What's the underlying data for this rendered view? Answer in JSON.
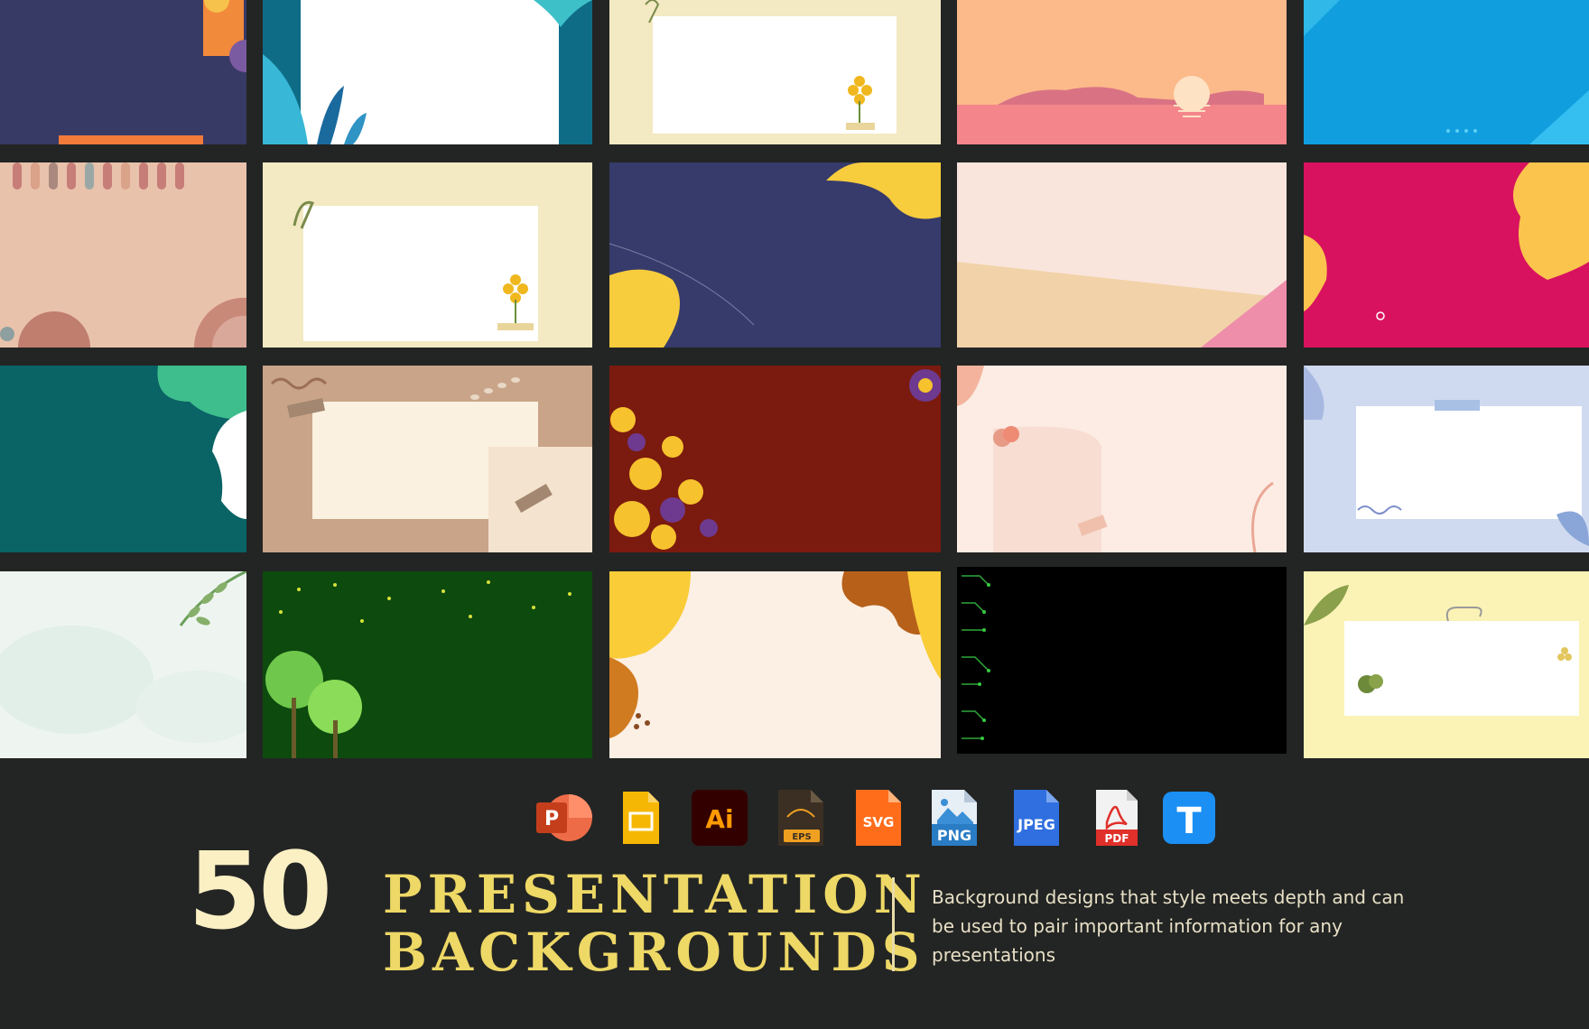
{
  "headline": {
    "count": "50",
    "title_line1": "PRESENTATION",
    "title_line2": "BACKGROUNDS",
    "description": "Background designs that style meets depth and can be used to pair important information for any presentations"
  },
  "formats": [
    {
      "name": "powerpoint-icon",
      "label": "P"
    },
    {
      "name": "google-slides-icon",
      "label": ""
    },
    {
      "name": "illustrator-icon",
      "label": "Ai"
    },
    {
      "name": "eps-icon",
      "label": "EPS"
    },
    {
      "name": "svg-icon",
      "label": "SVG"
    },
    {
      "name": "png-icon",
      "label": "PNG"
    },
    {
      "name": "jpeg-icon",
      "label": "JPEG"
    },
    {
      "name": "pdf-icon",
      "label": "PDF"
    },
    {
      "name": "template-net-icon",
      "label": "T"
    }
  ],
  "colors": {
    "background": "#232524",
    "count": "#fbefc4",
    "title": "#eed866",
    "description": "#e8e0c6"
  }
}
